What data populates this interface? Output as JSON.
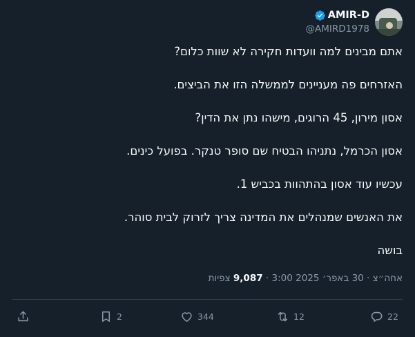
{
  "author": {
    "display_name": "AMIR-D",
    "handle": "@AMIRD1978",
    "verified": true,
    "verified_color": "#1d9bf0"
  },
  "tweet": {
    "lines": [
      "אתם מבינים למה וועדות חקירה לא שוות כלום?",
      "האזרחים פה מעניינים לממשלה הזו את הביצים.",
      "אסון מירון, 45 הרוגים, מישהו נתן את הדין?",
      "אסון הכרמל, נתניהו הבטיח שם סופר טנקר. בפועל כינים.",
      "עכשיו עוד אסון בהתהוות בכביש 1.",
      "את האנשים שמנהלים את המדינה צריך לזרוק לבית סוהר.",
      "בושה"
    ]
  },
  "meta": {
    "time": "3:00",
    "date": "אחה״צ · 30 באפר׳ 2025",
    "views_count": "9,087",
    "views_label": "צפיות"
  },
  "actions": {
    "reply_count": "22",
    "retweet_count": "12",
    "like_count": "344",
    "bookmark_count": "2"
  },
  "icons": {
    "reply": "reply-icon",
    "retweet": "retweet-icon",
    "like": "like-icon",
    "bookmark": "bookmark-icon",
    "share": "share-icon",
    "verified": "verified-badge-icon"
  },
  "colors": {
    "background": "#15202b",
    "text": "#f7f9f9",
    "secondary": "#8b98a5",
    "divider": "#38444d"
  }
}
